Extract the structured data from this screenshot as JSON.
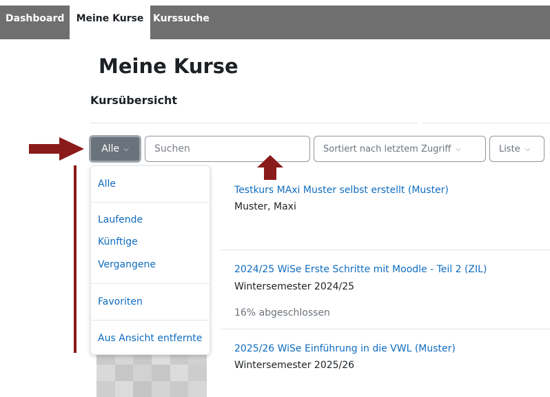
{
  "nav": {
    "tabs": [
      {
        "label": "Dashboard",
        "active": false
      },
      {
        "label": "Meine Kurse",
        "active": true
      },
      {
        "label": "Kurssuche",
        "active": false
      }
    ]
  },
  "page": {
    "title": "Meine Kurse",
    "section": "Kursübersicht"
  },
  "controls": {
    "filter_label": "Alle",
    "search_placeholder": "Suchen",
    "sort_label": "Sortiert nach letztem Zugriff",
    "view_label": "Liste",
    "caret_icon": "chevron-down-icon"
  },
  "dropdown": {
    "items": [
      "Alle",
      "Laufende",
      "Künftige",
      "Vergangene",
      "Favoriten",
      "Aus Ansicht entfernte"
    ]
  },
  "courses": [
    {
      "title": "Testkurs MAxi Muster selbst erstellt (Muster)",
      "subtitle": "Muster, Maxi"
    },
    {
      "title": "2024/25 WiSe Erste Schritte mit Moodle - Teil 2 (ZIL)",
      "subtitle": "Wintersemester 2024/25",
      "progress_text": "16% abgeschlossen",
      "progress": 0.16
    },
    {
      "title": "2025/26 WiSe Einführung in die VWL (Muster)",
      "subtitle": "Wintersemester 2025/26"
    }
  ],
  "annotation": {
    "color": "#8b1a1a"
  },
  "colors": {
    "nav_bg": "#6f6f6f",
    "link": "#0f6cbf",
    "filter_button_bg": "#6a737b"
  }
}
